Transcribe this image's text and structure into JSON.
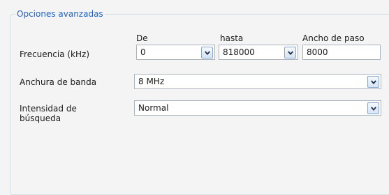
{
  "group": {
    "title": "Opciones avanzadas"
  },
  "headers": {
    "from": "De",
    "to": "hasta",
    "step": "Ancho de paso"
  },
  "frequency": {
    "label": "Frecuencia (kHz)",
    "from_value": "0",
    "to_value": "818000",
    "step_value": "8000"
  },
  "bandwidth": {
    "label": "Anchura de banda",
    "value": "8 MHz"
  },
  "intensity": {
    "label_line1": "Intensidad de",
    "label_line2": "búsqueda",
    "value": "Normal"
  },
  "icons": {
    "dropdown": "chevron-down-icon"
  },
  "colors": {
    "legend": "#1f63c6",
    "border": "#a9b4be",
    "button_border": "#8ba6c8"
  }
}
